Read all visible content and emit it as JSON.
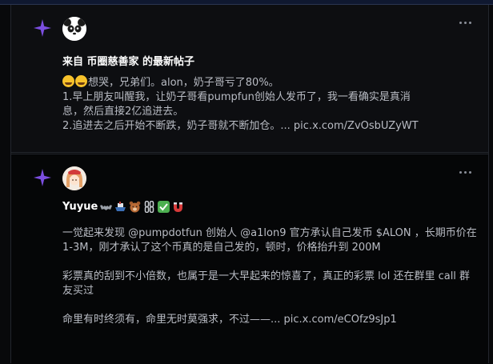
{
  "colors": {
    "background": "#08090b",
    "card": "#0d0e11",
    "accent_star": "#7b4ee0",
    "text_primary": "#ffffff",
    "text_secondary": "#b9bcc4"
  },
  "posts": [
    {
      "icon": "sparkle-icon",
      "avatar": "panda-avatar",
      "heading": "来自 币圈慈善家 的最新帖子",
      "lines": [
        "想哭，兄弟们。alon，奶子哥亏了80%。",
        "1.早上朋友叫醒我，让奶子哥看pumpfun创始人发币了，我一看确实是真消",
        "息，然后直接2亿追进去。",
        "2.追进去之后开始不断跌，奶子哥就不断加仓。... pic.x.com/ZvOsbUZyWT"
      ],
      "leading_emojis": [
        "crying-face-icon",
        "crying-face-icon"
      ]
    },
    {
      "icon": "sparkle-icon",
      "avatar": "anime-girl-avatar",
      "name": "Yuyue",
      "name_emojis": [
        "bat-icon",
        "ship-icon",
        "bear-icon",
        "chain-icon",
        "chain-icon",
        "check-icon",
        "magnet-icon"
      ],
      "paragraphs": [
        "一觉起来发现 @pumpdotfun 创始人 @a1lon9 官方承认自己发币 $ALON ，长期币价在 1-3M，刚才承认了这个币真的是自己发的，顿时，价格抬升到 200M",
        "彩票真的刮到不小倍数，也属于是一大早起来的惊喜了，真正的彩票 lol 还在群里 call 群友买过",
        "命里有时终须有，命里无时莫强求，不过——... pic.x.com/eCOfz9sJp1"
      ]
    }
  ]
}
